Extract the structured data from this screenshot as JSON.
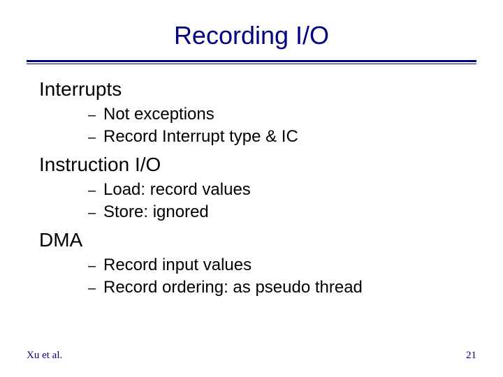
{
  "title": "Recording I/O",
  "sections": [
    {
      "heading": "Interrupts",
      "items": [
        "Not exceptions",
        "Record Interrupt type & IC"
      ]
    },
    {
      "heading": "Instruction I/O",
      "items": [
        "Load: record values",
        "Store: ignored"
      ]
    },
    {
      "heading": "DMA",
      "items": [
        "Record input values",
        "Record ordering: as pseudo thread"
      ]
    }
  ],
  "footer": {
    "left": "Xu et al.",
    "right": "21"
  }
}
